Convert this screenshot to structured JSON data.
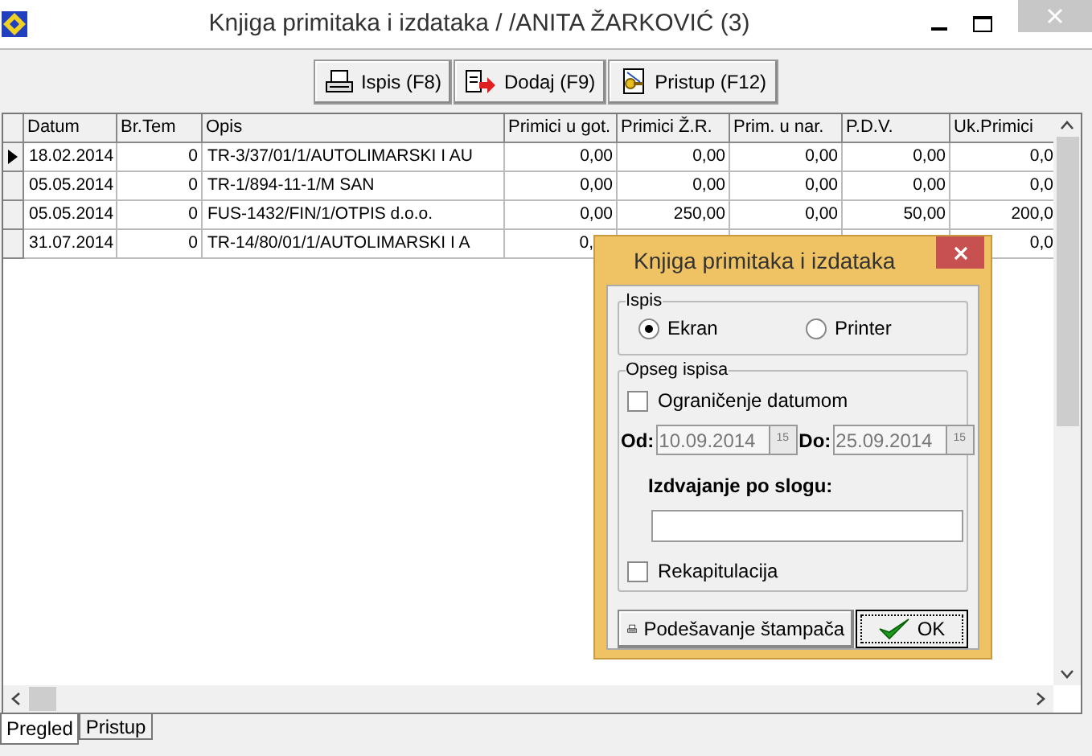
{
  "window": {
    "title": "Knjiga primitaka i izdataka /  /ANITA ŽARKOVIĆ (3)"
  },
  "toolbar": [
    {
      "kind": "print",
      "label": "Ispis (F8)"
    },
    {
      "kind": "add",
      "label": "Dodaj (F9)"
    },
    {
      "kind": "access",
      "label": "Pristup (F12)"
    }
  ],
  "table": {
    "columns": [
      "Datum",
      "Br.Tem",
      "Opis",
      "Primici u got.",
      "Primici Ž.R.",
      "Prim. u nar.",
      "P.D.V.",
      "Uk.Primici"
    ],
    "rows": [
      {
        "selected": true,
        "cells": [
          "18.02.2014",
          "0",
          "TR-3/37/01/1/AUTOLIMARSKI I AU",
          "0,00",
          "0,00",
          "0,00",
          "0,00",
          "0,0"
        ]
      },
      {
        "selected": false,
        "cells": [
          "05.05.2014",
          "0",
          "TR-1/894-11-1/M SAN",
          "0,00",
          "0,00",
          "0,00",
          "0,00",
          "0,0"
        ]
      },
      {
        "selected": false,
        "cells": [
          "05.05.2014",
          "0",
          "FUS-1432/FIN/1/OTPIS d.o.o.",
          "0,00",
          "250,00",
          "0,00",
          "50,00",
          "200,0"
        ]
      },
      {
        "selected": false,
        "cells": [
          "31.07.2014",
          "0",
          "TR-14/80/01/1/AUTOLIMARSKI I A",
          "0,",
          null,
          null,
          null,
          "0,0"
        ]
      }
    ]
  },
  "tabs": [
    {
      "label": "Pregled",
      "selected": true
    },
    {
      "label": "Pristup",
      "selected": false
    }
  ],
  "dialog": {
    "title": "Knjiga primitaka i izdataka",
    "output_group": {
      "title": "Ispis",
      "options": [
        {
          "label": "Ekran",
          "selected": true
        },
        {
          "label": "Printer",
          "selected": false
        }
      ]
    },
    "range_group": {
      "title": "Opseg ispisa",
      "date_limit": {
        "label": "Ograničenje datumom",
        "checked": false
      },
      "from": {
        "label": "Od:",
        "value": "10.09.2014",
        "disabled": true,
        "calendar_label": "15"
      },
      "to": {
        "label": "Do:",
        "value": "25.09.2014",
        "disabled": true,
        "calendar_label": "15"
      },
      "filter_label": "Izdvajanje po slogu:",
      "recap": {
        "label": "Rekapitulacija",
        "checked": false
      }
    },
    "buttons": [
      {
        "kind": "printer",
        "label": "Podešavanje štampača"
      },
      {
        "kind": "ok",
        "label": "OK"
      }
    ]
  }
}
